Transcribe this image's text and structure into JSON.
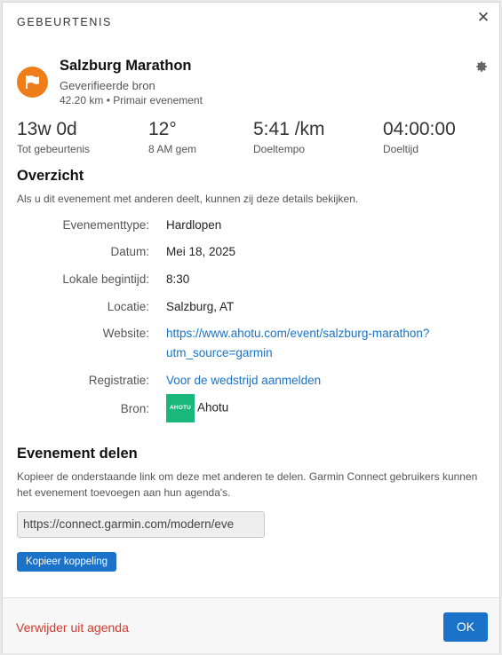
{
  "dialog": {
    "title": "GEBEURTENIS",
    "close_icon": "close-icon"
  },
  "event": {
    "name": "Salzburg Marathon",
    "verified": "Geverifieerde bron",
    "meta": "42.20 km • Primair evenement",
    "logo_icon": "flag-icon",
    "settings_icon": "gear-icon"
  },
  "stats": [
    {
      "value": "13w 0d",
      "label": "Tot gebeurtenis"
    },
    {
      "value": "12°",
      "label": "8 AM gem"
    },
    {
      "value": "5:41 /km",
      "label": "Doeltempo"
    },
    {
      "value": "04:00:00",
      "label": "Doeltijd"
    }
  ],
  "overview": {
    "heading": "Overzicht",
    "description": "Als u dit evenement met anderen deelt, kunnen zij deze details bekijken.",
    "rows": {
      "type": {
        "label": "Evenementtype:",
        "value": "Hardlopen"
      },
      "date": {
        "label": "Datum:",
        "value": "Mei 18, 2025"
      },
      "start": {
        "label": "Lokale begintijd:",
        "value": "8:30"
      },
      "location": {
        "label": "Locatie:",
        "value": "Salzburg, AT"
      },
      "website": {
        "label": "Website:",
        "line1": "https://www.ahotu.com/event/salzburg-marathon?",
        "line2": "utm_source=garmin"
      },
      "registration": {
        "label": "Registratie:",
        "value": "Voor de wedstrijd aanmelden"
      },
      "source": {
        "label": "Bron:",
        "logo_text": "AHOTU",
        "value": "Ahotu"
      }
    }
  },
  "share": {
    "heading": "Evenement delen",
    "description": "Kopieer de onderstaande link om deze met anderen te delen. Garmin Connect gebruikers kunnen het evenement toevoegen aan hun agenda's.",
    "url": "https://connect.garmin.com/modern/eve",
    "copy_label": "Kopieer koppeling"
  },
  "footer": {
    "remove_label": "Verwijder uit agenda",
    "ok_label": "OK"
  },
  "colors": {
    "accent": "#1a73c8",
    "danger": "#d33a2c",
    "logo_orange": "#ef7d1a",
    "ahotu_green": "#19b77b"
  }
}
